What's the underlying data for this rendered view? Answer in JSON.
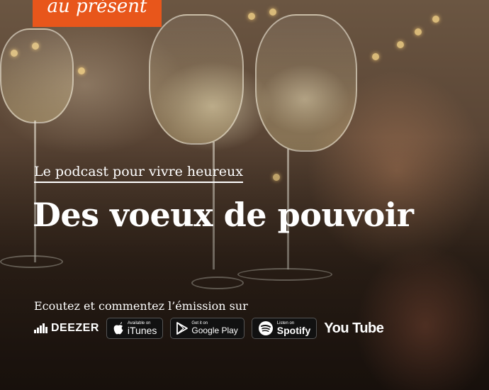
{
  "brand": {
    "logo_text": "au présent",
    "logo_color": "#e8561b"
  },
  "episode": {
    "subtitle": "Le podcast pour vivre heureux",
    "title": "Des voeux de pouvoir"
  },
  "listen": {
    "label": "Ecoutez et commentez l’émission sur",
    "platforms": {
      "deezer": {
        "name": "DEEZER",
        "icon": "deezer-equalizer-icon"
      },
      "itunes": {
        "small": "Available on",
        "name": "iTunes",
        "icon": "apple-icon"
      },
      "googleplay": {
        "small": "Get it on",
        "name": "Google Play",
        "icon": "play-triangle-icon"
      },
      "spotify": {
        "small": "Listen on",
        "name": "Spotify",
        "icon": "spotify-icon"
      },
      "youtube": {
        "name": "You Tube",
        "icon": "youtube-wordmark"
      }
    }
  }
}
